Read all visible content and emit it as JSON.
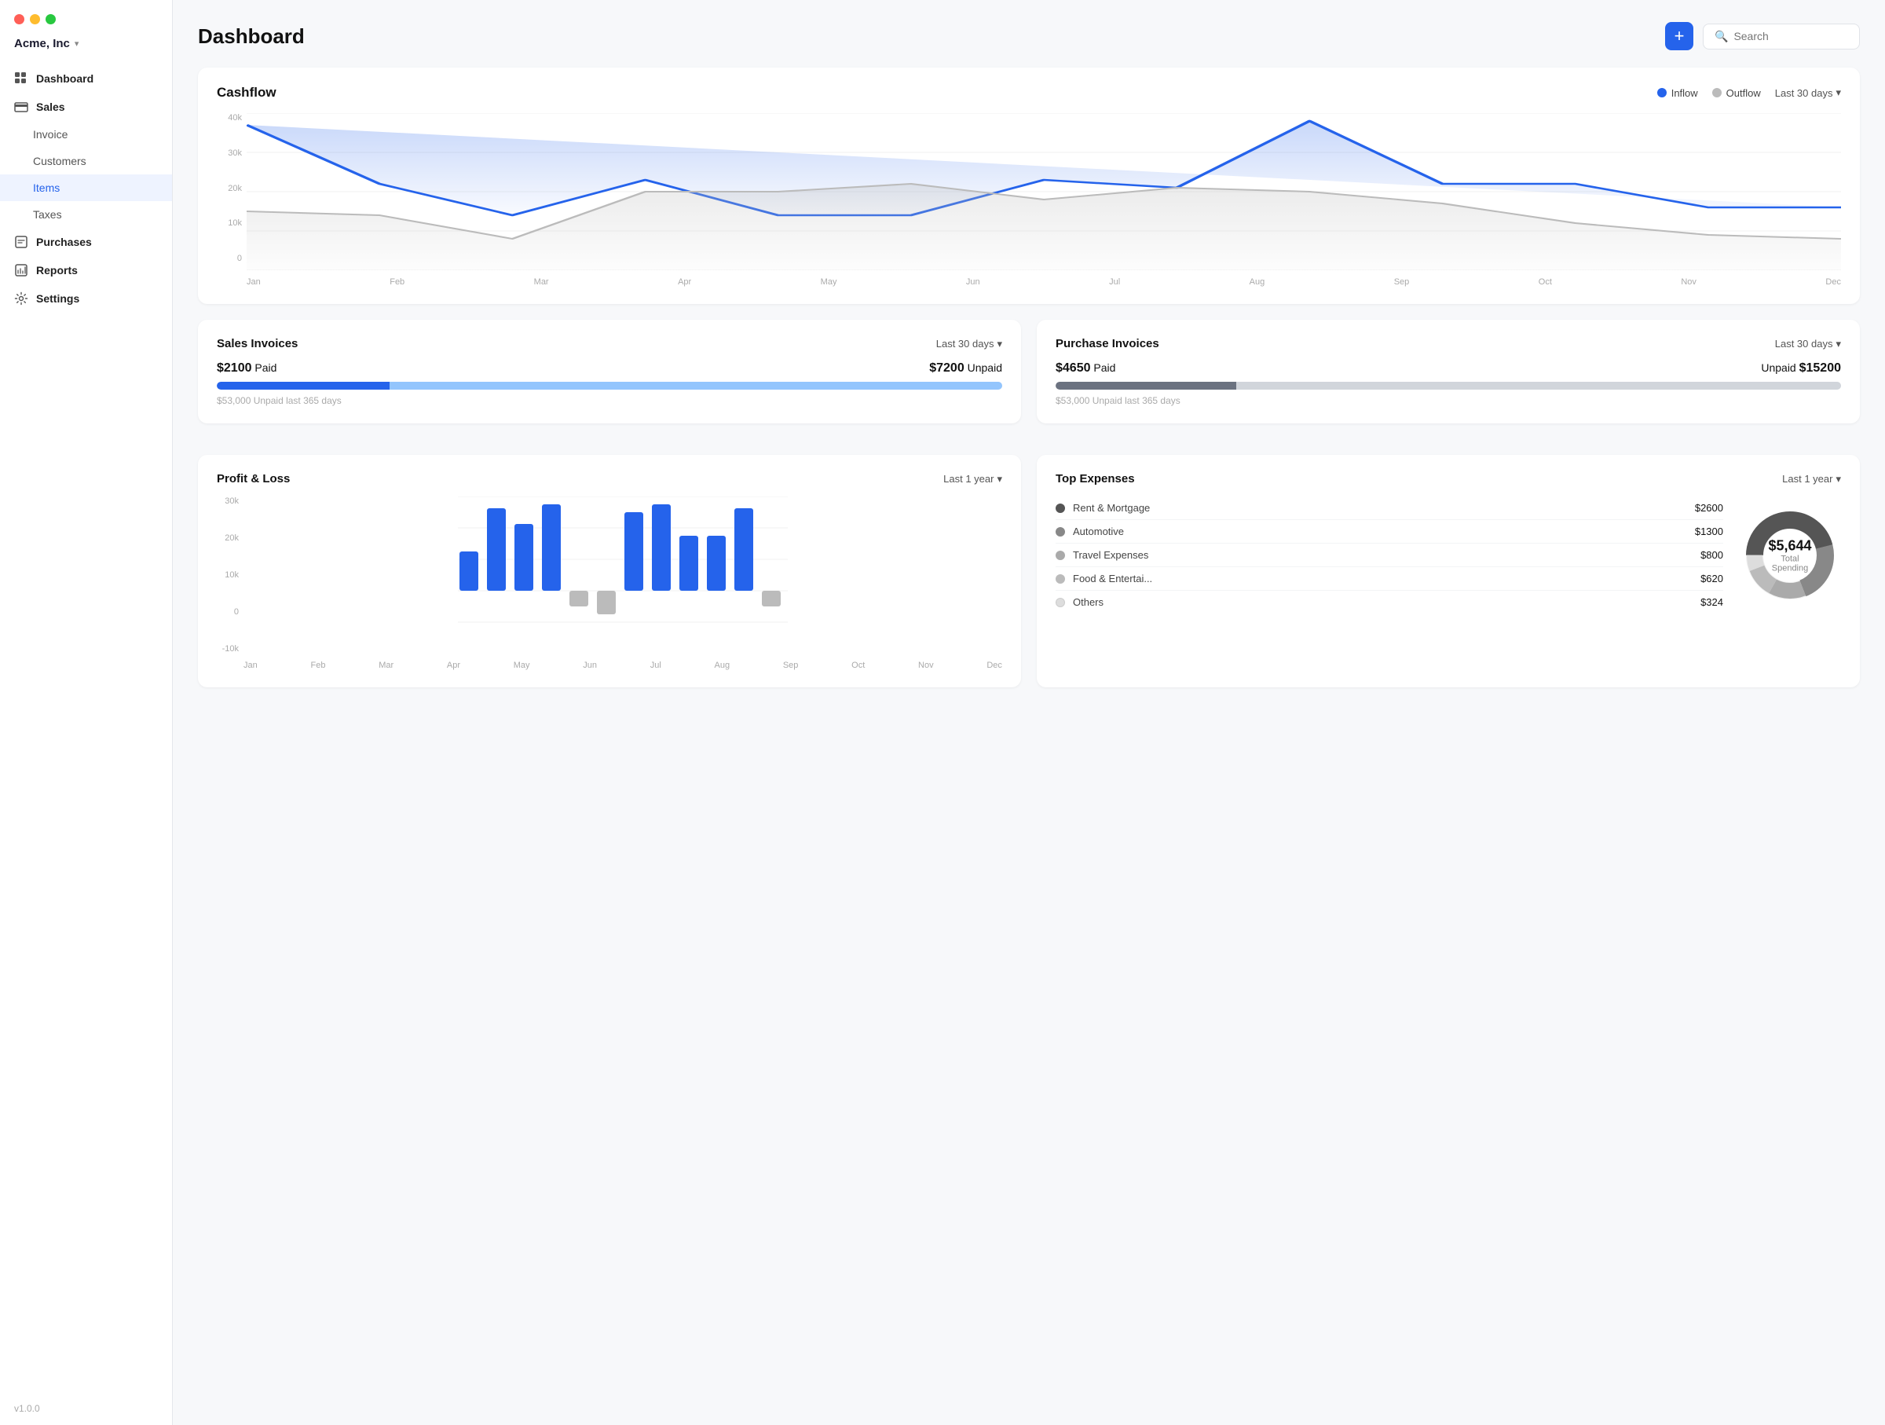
{
  "app": {
    "version": "v1.0.0",
    "company": "Acme, Inc"
  },
  "sidebar": {
    "items": [
      {
        "id": "dashboard",
        "label": "Dashboard",
        "type": "parent",
        "icon": "grid-icon"
      },
      {
        "id": "sales",
        "label": "Sales",
        "type": "parent",
        "icon": "sales-icon"
      },
      {
        "id": "invoice",
        "label": "Invoice",
        "type": "child",
        "active": false
      },
      {
        "id": "customers",
        "label": "Customers",
        "type": "child",
        "active": false
      },
      {
        "id": "items",
        "label": "Items",
        "type": "child",
        "active": true
      },
      {
        "id": "taxes",
        "label": "Taxes",
        "type": "child",
        "active": false
      },
      {
        "id": "purchases",
        "label": "Purchases",
        "type": "parent",
        "icon": "purchases-icon"
      },
      {
        "id": "reports",
        "label": "Reports",
        "type": "parent",
        "icon": "reports-icon"
      },
      {
        "id": "settings",
        "label": "Settings",
        "type": "parent",
        "icon": "settings-icon"
      }
    ]
  },
  "header": {
    "title": "Dashboard",
    "add_button_label": "+",
    "search_placeholder": "Search"
  },
  "cashflow": {
    "title": "Cashflow",
    "legend_inflow": "Inflow",
    "legend_outflow": "Outflow",
    "period": "Last 30 days",
    "y_labels": [
      "40k",
      "30k",
      "20k",
      "10k",
      "0"
    ],
    "x_labels": [
      "Jan",
      "Feb",
      "Mar",
      "Apr",
      "May",
      "Jun",
      "Jul",
      "Aug",
      "Sep",
      "Oct",
      "Nov",
      "Dec"
    ]
  },
  "sales_invoices": {
    "title": "Sales Invoices",
    "period": "Last 30 days",
    "paid_label": "Paid",
    "paid_amount": "$2100",
    "unpaid_label": "Unpaid",
    "unpaid_amount": "$7200",
    "bar_paid_pct": 22,
    "note": "$53,000 Unpaid last 365 days"
  },
  "purchase_invoices": {
    "title": "Purchase Invoices",
    "period": "Last 30 days",
    "paid_label": "Paid",
    "paid_amount": "$4650",
    "unpaid_label": "Unpaid",
    "unpaid_amount": "$15200",
    "bar_paid_pct": 23,
    "note": "$53,000 Unpaid last 365 days"
  },
  "profit_loss": {
    "title": "Profit & Loss",
    "period": "Last 1 year",
    "x_labels": [
      "Jan",
      "Feb",
      "Mar",
      "Apr",
      "May",
      "Jun",
      "Jul",
      "Aug",
      "Sep",
      "Oct",
      "Nov",
      "Dec"
    ],
    "y_labels": [
      "30k",
      "20k",
      "10k",
      "0",
      "-10k"
    ],
    "bars": [
      {
        "month": "Jan",
        "value": 10,
        "negative": false
      },
      {
        "month": "Feb",
        "value": 27,
        "negative": false
      },
      {
        "month": "Mar",
        "value": 17,
        "negative": false
      },
      {
        "month": "Apr",
        "value": 22,
        "negative": false
      },
      {
        "month": "May",
        "value": 4,
        "negative": true
      },
      {
        "month": "Jun",
        "value": 6,
        "negative": true
      },
      {
        "month": "Jul",
        "value": 20,
        "negative": false
      },
      {
        "month": "Aug",
        "value": 26,
        "negative": false
      },
      {
        "month": "Sep",
        "value": 14,
        "negative": false
      },
      {
        "month": "Oct",
        "value": 14,
        "negative": false
      },
      {
        "month": "Nov",
        "value": 21,
        "negative": false
      },
      {
        "month": "Dec",
        "value": 4,
        "negative": true
      }
    ]
  },
  "top_expenses": {
    "title": "Top Expenses",
    "period": "Last 1 year",
    "total": "$5,644",
    "total_label": "Total Spending",
    "items": [
      {
        "name": "Rent & Mortgage",
        "amount": "$2600",
        "color": "#555",
        "pct": 46
      },
      {
        "name": "Automotive",
        "amount": "$1300",
        "color": "#888",
        "pct": 23
      },
      {
        "name": "Travel Expenses",
        "amount": "$800",
        "color": "#aaa",
        "pct": 14
      },
      {
        "name": "Food & Entertai...",
        "amount": "$620",
        "color": "#bbb",
        "pct": 11
      },
      {
        "name": "Others",
        "amount": "$324",
        "color": "#ddd",
        "pct": 6
      }
    ]
  }
}
